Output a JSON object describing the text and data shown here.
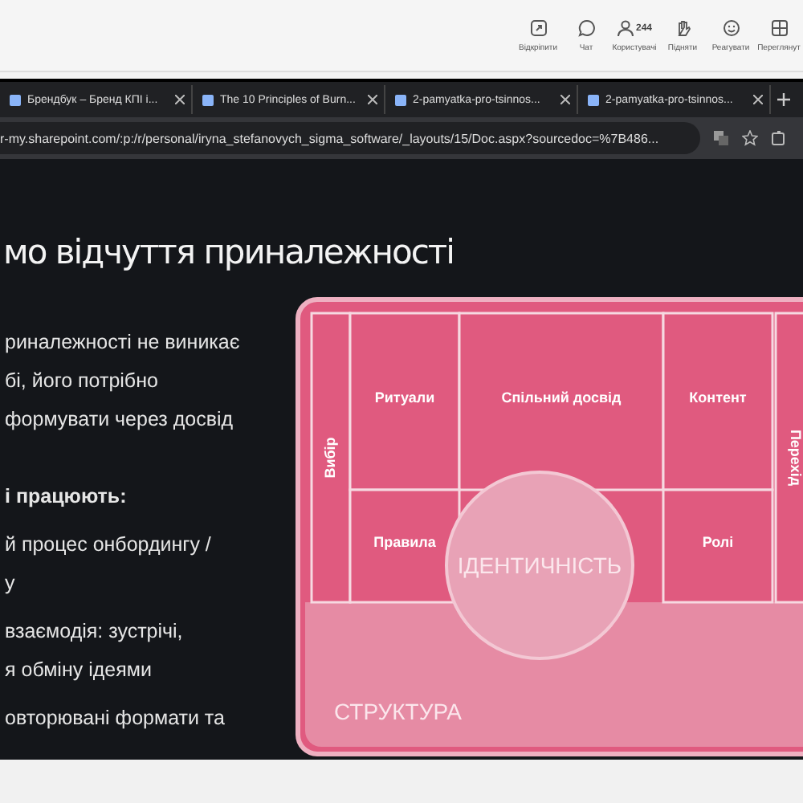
{
  "toolbar": {
    "items": [
      {
        "kind": "unpin",
        "label": "Відкріпити"
      },
      {
        "kind": "chat",
        "label": "Чат"
      },
      {
        "kind": "people",
        "label": "Користувачі",
        "count": "244"
      },
      {
        "kind": "hand",
        "label": "Підняти"
      },
      {
        "kind": "emoji",
        "label": "Реагувати"
      },
      {
        "kind": "grid",
        "label": "Переглянут"
      }
    ]
  },
  "browser": {
    "tabs": [
      {
        "title": "Брендбук – Бренд КПІ і..."
      },
      {
        "title": "The 10 Principles of Burn..."
      },
      {
        "title": "2-pamyatka-pro-tsinnos..."
      },
      {
        "title": "2-pamyatka-pro-tsinnos..."
      }
    ],
    "address": "r-my.sharepoint.com/:p:/r/personal/iryna_stefanovych_sigma_software/_layouts/15/Doc.aspx?sourcedoc=%7B486..."
  },
  "slide": {
    "title": "мо відчуття приналежності",
    "paragraphs": [
      {
        "bold": false,
        "lines": [
          "риналежності не виникає",
          "бі, його потрібно",
          "формувати через досвід"
        ]
      },
      {
        "bold": true,
        "lines": [
          "і працюють:"
        ]
      },
      {
        "bold": false,
        "lines": [
          "й процес онбордингу /",
          "у"
        ]
      },
      {
        "bold": false,
        "lines": [
          "взаємодія: зустрічі,",
          "я обміну ідеями"
        ]
      },
      {
        "bold": false,
        "lines": [
          "овторювані формати та"
        ]
      }
    ],
    "diagram": {
      "cells": [
        "Вибір",
        "Ритуали",
        "Спільний досвід",
        "Контент",
        "Перехід",
        "Правила",
        "Ролі"
      ],
      "center": "ІДЕНТИЧНІСТЬ",
      "base": "СТРУКТУРА"
    }
  }
}
